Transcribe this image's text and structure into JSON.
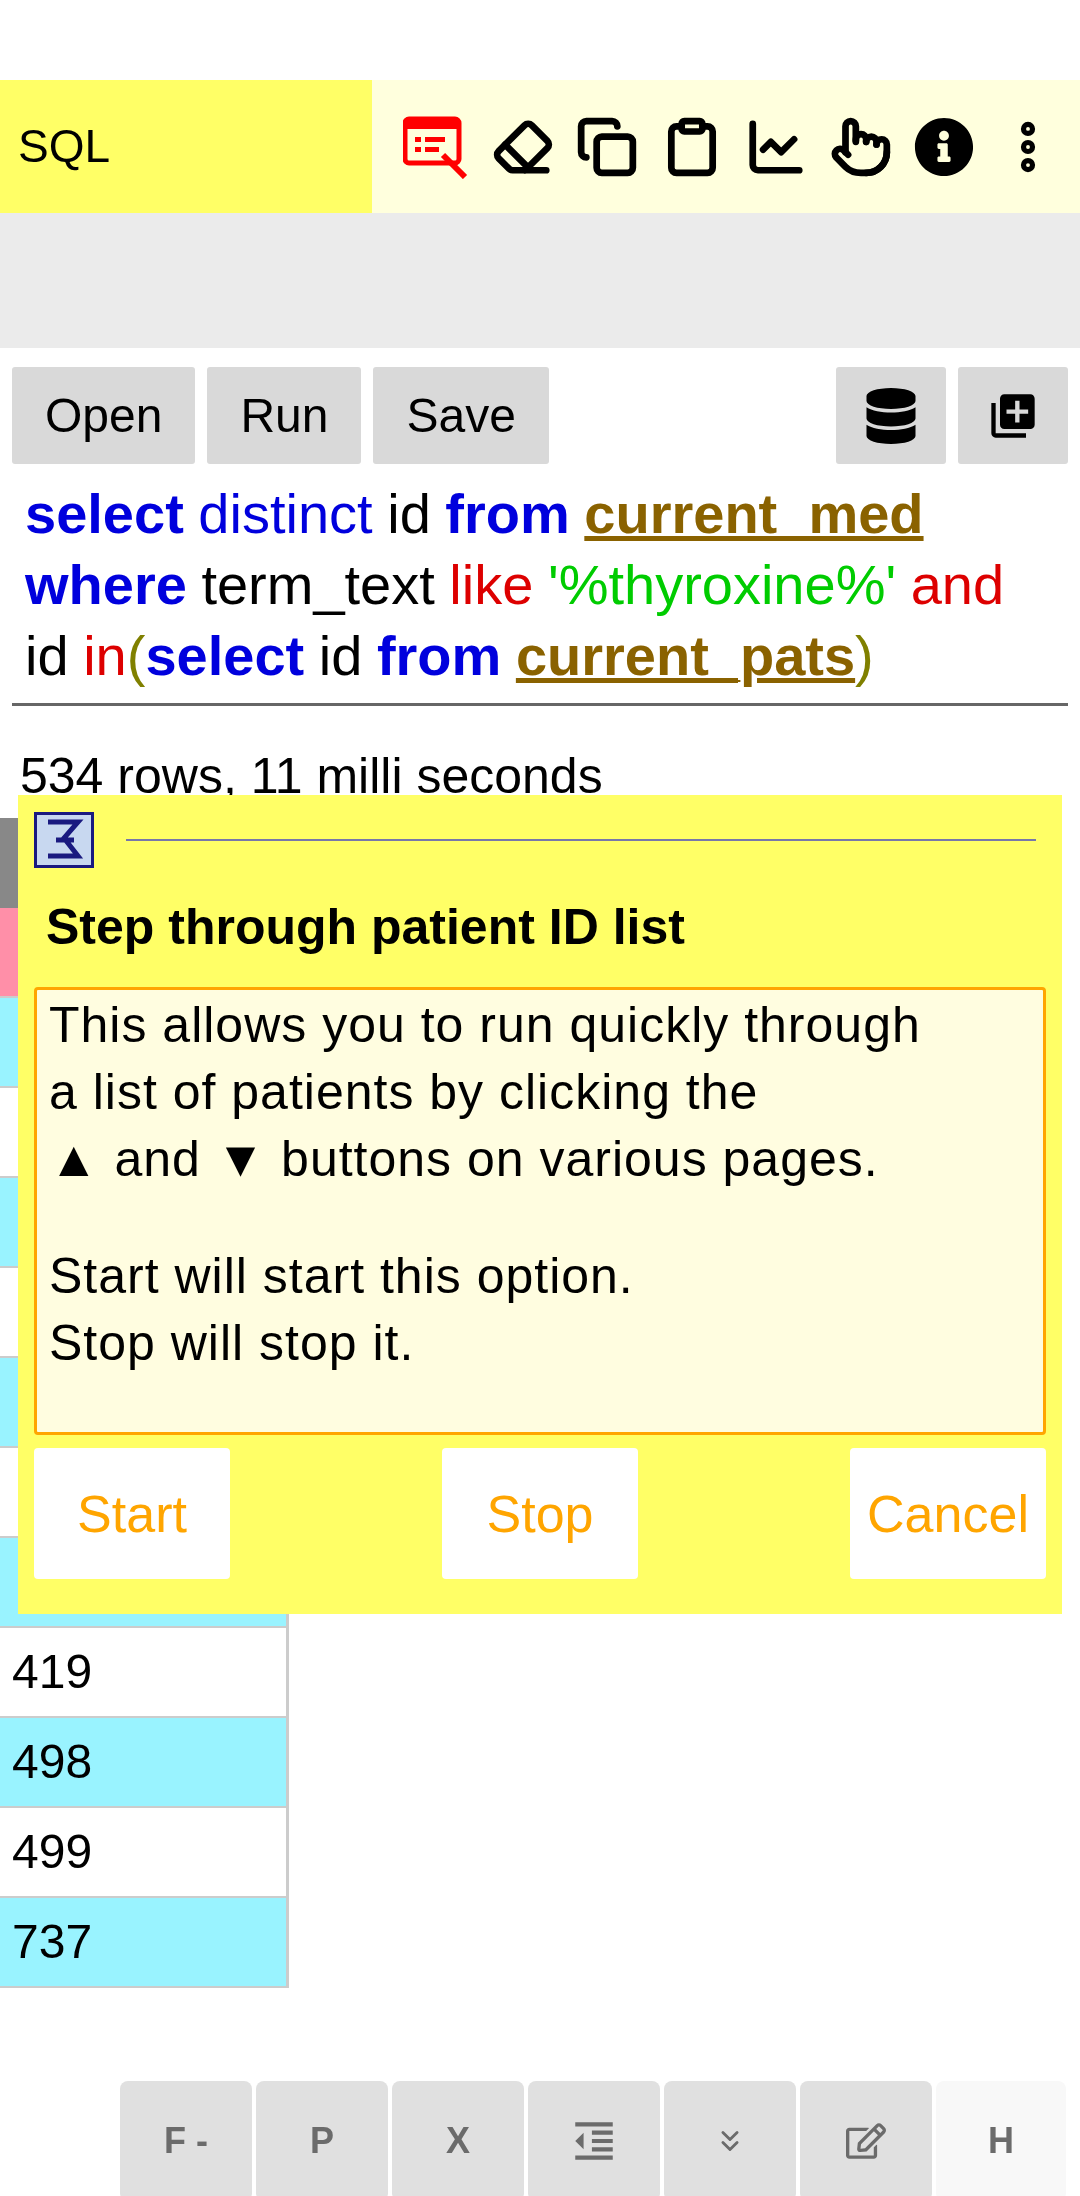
{
  "toolbar": {
    "title": "SQL"
  },
  "query_buttons": [
    "Open",
    "Run",
    "Save"
  ],
  "sql": [
    [
      [
        {
          "text": "select",
          "kind": "keyword"
        }
      ],
      [
        {
          "text": "distinct",
          "kind": "modifier"
        }
      ],
      [
        {
          "text": "id",
          "kind": "plain"
        }
      ],
      [
        {
          "text": "from",
          "kind": "keyword"
        }
      ],
      [
        {
          "text": "current_med",
          "kind": "table"
        }
      ]
    ],
    [
      [
        {
          "text": "where",
          "kind": "keyword"
        }
      ],
      [
        {
          "text": "term_text",
          "kind": "plain"
        }
      ],
      [
        {
          "text": "like",
          "kind": "operator"
        }
      ],
      [
        {
          "text": "'%thyroxine%'",
          "kind": "string"
        }
      ],
      [
        {
          "text": "and",
          "kind": "operator"
        }
      ]
    ],
    [
      [
        {
          "text": "id",
          "kind": "plain"
        }
      ],
      [
        {
          "text": "in",
          "kind": "operator"
        },
        {
          "text": "(",
          "kind": "paren"
        },
        {
          "text": "select",
          "kind": "keyword"
        }
      ],
      [
        {
          "text": "id",
          "kind": "plain"
        }
      ],
      [
        {
          "text": "from",
          "kind": "keyword"
        }
      ],
      [
        {
          "text": "current_pats",
          "kind": "table"
        },
        {
          "text": ")",
          "kind": "paren"
        }
      ]
    ]
  ],
  "result_summary": "534 rows, 11 milli seconds",
  "table": {
    "rows": [
      {
        "color": "#ff8fa8"
      },
      {
        "color": "#99f3ff"
      },
      {
        "color": "#ffffff"
      },
      {
        "color": "#99f3ff"
      },
      {
        "color": "#ffffff"
      },
      {
        "color": "#99f3ff"
      },
      {
        "color": "#ffffff"
      },
      {
        "color": "#99f3ff"
      },
      {
        "cell": "419",
        "color": "#ffffff"
      },
      {
        "cell": "498",
        "color": "#99f3ff"
      },
      {
        "cell": "499",
        "color": "#ffffff"
      },
      {
        "cell": "737",
        "color": "#99f3ff"
      }
    ]
  },
  "dialog": {
    "title": "Step through patient ID list",
    "paragraphs": [
      "This allows you to run quickly through\na list of patients by clicking the\n▲ and ▼ buttons on various pages.",
      "Start will start this option.\nStop will stop it."
    ],
    "buttons": [
      "Start",
      "Stop",
      "Cancel"
    ]
  },
  "bottom_bar": [
    {
      "kind": "text",
      "label": "F -"
    },
    {
      "kind": "text",
      "label": "P"
    },
    {
      "kind": "text",
      "label": "X"
    },
    {
      "kind": "indent"
    },
    {
      "kind": "chevrons"
    },
    {
      "kind": "edit"
    },
    {
      "kind": "text",
      "label": "H",
      "disabled": true
    }
  ]
}
